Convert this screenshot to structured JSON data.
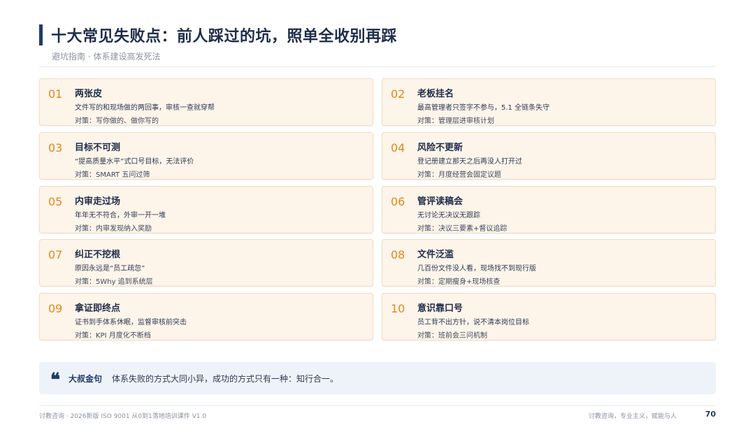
{
  "header": {
    "title": "十大常见失败点：前人踩过的坑，照单全收别再踩",
    "subtitle": "避坑指南 · 体系建设高发死法"
  },
  "cards": [
    {
      "num": "01",
      "name": "两张皮",
      "desc": "文件写的和现场做的两回事，审核一查就穿帮",
      "fix": "对策：写你做的、做你写的"
    },
    {
      "num": "02",
      "name": "老板挂名",
      "desc": "最高管理者只签字不参与，5.1 全链条失守",
      "fix": "对策：管理层进审核计划"
    },
    {
      "num": "03",
      "name": "目标不可测",
      "desc": "“提高质量水平”式口号目标，无法评价",
      "fix": "对策：SMART 五问过筛"
    },
    {
      "num": "04",
      "name": "风险不更新",
      "desc": "登记册建立那天之后再没人打开过",
      "fix": "对策：月度经营会固定议题"
    },
    {
      "num": "05",
      "name": "内审走过场",
      "desc": "年年无不符合，外审一开一堆",
      "fix": "对策：内审发现纳入奖励"
    },
    {
      "num": "06",
      "name": "管评读稿会",
      "desc": "无讨论无决议无跟踪",
      "fix": "对策：决议三要素+督议追踪"
    },
    {
      "num": "07",
      "name": "纠正不挖根",
      "desc": "原因永远是“员工疏忽”",
      "fix": "对策：5Why 追到系统层"
    },
    {
      "num": "08",
      "name": "文件泛滥",
      "desc": "几百份文件没人看，现场找不到现行版",
      "fix": "对策：定期瘦身+现场核查"
    },
    {
      "num": "09",
      "name": "拿证即终点",
      "desc": "证书到手体系休眠，监督审核前突击",
      "fix": "对策：KPI 月度化不断档"
    },
    {
      "num": "10",
      "name": "意识靠口号",
      "desc": "员工背不出方针，说不清本岗位目标",
      "fix": "对策：班前会三问机制"
    }
  ],
  "quote": {
    "icon": "quote-mark-icon",
    "label": "大叔金句",
    "text": "体系失败的方式大同小异，成功的方式只有一种：知行合一。"
  },
  "footer": {
    "left": "讨教咨询 · 2026新版 ISO 9001 从0到1落地培训课件 V1.0",
    "right": "讨教咨询，专业主义，赋能与人",
    "page": "70"
  },
  "colors": {
    "accent": "#1f3a6b",
    "number": "#e0891e",
    "card_bg": "#fdf4ea",
    "card_border": "#f2dcc2",
    "quote_bg": "#eef3f9"
  }
}
